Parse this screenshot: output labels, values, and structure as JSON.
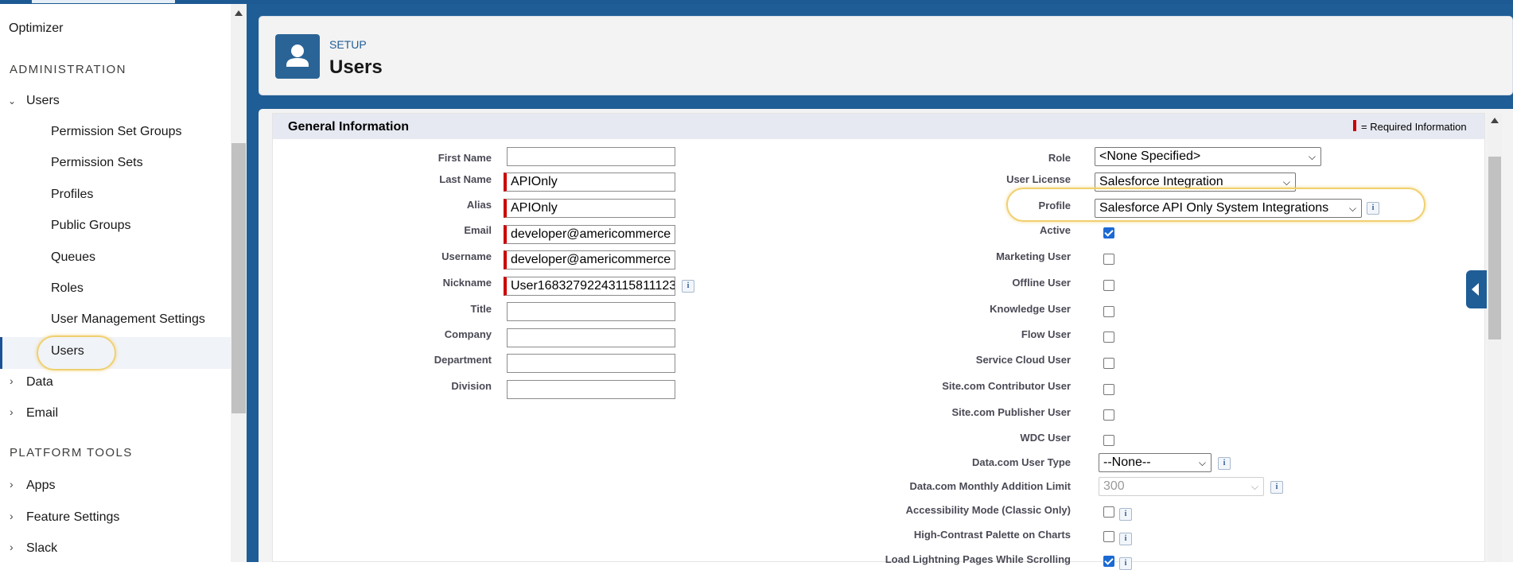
{
  "sidebar": {
    "optimizer": "Optimizer",
    "administration": "ADMINISTRATION",
    "users_group": "Users",
    "users_children": [
      "Permission Set Groups",
      "Permission Sets",
      "Profiles",
      "Public Groups",
      "Queues",
      "Roles",
      "User Management Settings",
      "Users"
    ],
    "data": "Data",
    "email": "Email",
    "platform_tools": "PLATFORM TOOLS",
    "apps": "Apps",
    "feature_settings": "Feature Settings",
    "slack": "Slack"
  },
  "header": {
    "breadcrumb": "SETUP",
    "title": "Users"
  },
  "section": {
    "title": "General Information",
    "required_note": "= Required Information"
  },
  "left_fields": {
    "first_name": {
      "label": "First Name",
      "value": ""
    },
    "last_name": {
      "label": "Last Name",
      "value": "APIOnly"
    },
    "alias": {
      "label": "Alias",
      "value": "APIOnly"
    },
    "email": {
      "label": "Email",
      "value": "developer@americommerce"
    },
    "username": {
      "label": "Username",
      "value": "developer@americommerce"
    },
    "nickname": {
      "label": "Nickname",
      "value": "User16832792243115811123"
    },
    "title": {
      "label": "Title",
      "value": ""
    },
    "company": {
      "label": "Company",
      "value": ""
    },
    "department": {
      "label": "Department",
      "value": ""
    },
    "division": {
      "label": "Division",
      "value": ""
    }
  },
  "right_fields": {
    "role": {
      "label": "Role",
      "value": "<None Specified>"
    },
    "user_license": {
      "label": "User License",
      "value": "Salesforce Integration"
    },
    "profile": {
      "label": "Profile",
      "value": "Salesforce API Only System Integrations"
    },
    "active": {
      "label": "Active",
      "checked": true
    },
    "marketing_user": {
      "label": "Marketing User",
      "checked": false
    },
    "offline_user": {
      "label": "Offline User",
      "checked": false
    },
    "knowledge_user": {
      "label": "Knowledge User",
      "checked": false
    },
    "flow_user": {
      "label": "Flow User",
      "checked": false
    },
    "service_cloud_user": {
      "label": "Service Cloud User",
      "checked": false
    },
    "site_contributor": {
      "label": "Site.com Contributor User",
      "checked": false
    },
    "site_publisher": {
      "label": "Site.com Publisher User",
      "checked": false
    },
    "wdc_user": {
      "label": "WDC User",
      "checked": false
    },
    "datacom_user_type": {
      "label": "Data.com User Type",
      "value": "--None--"
    },
    "datacom_monthly_limit": {
      "label": "Data.com Monthly Addition Limit",
      "value": "300"
    },
    "accessibility_mode": {
      "label": "Accessibility Mode (Classic Only)",
      "checked": false
    },
    "high_contrast": {
      "label": "High-Contrast Palette on Charts",
      "checked": false
    },
    "load_lightning": {
      "label": "Load Lightning Pages While Scrolling",
      "checked": true
    }
  },
  "info_glyph": "i",
  "colors": {
    "brand": "#1f5d96",
    "required": "#cc0000",
    "highlight": "#f0d070",
    "checkbox": "#1b6ad3"
  }
}
